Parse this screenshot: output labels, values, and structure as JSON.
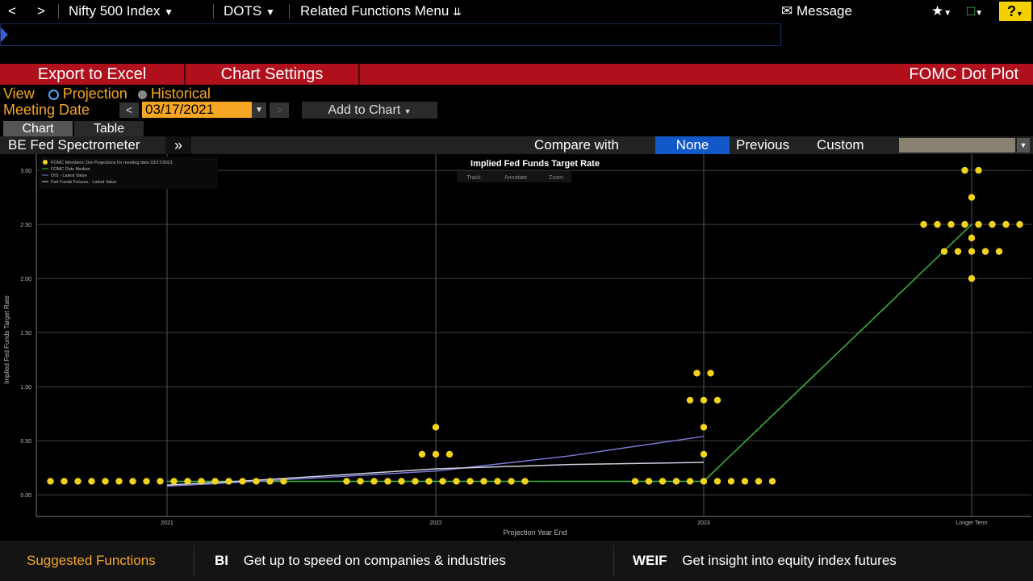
{
  "topbar": {
    "back": "<",
    "forward": ">",
    "security": "Nifty 500 Index",
    "function": "DOTS",
    "related": "Related Functions Menu",
    "message": "Message",
    "help": "?"
  },
  "actions": {
    "export": "Export to Excel",
    "settings": "Chart Settings",
    "title": "FOMC Dot Plot"
  },
  "view": {
    "label": "View",
    "projection": "Projection",
    "historical": "Historical"
  },
  "meeting": {
    "label": "Meeting Date",
    "date": "03/17/2021",
    "prev": "<",
    "next": ">",
    "add_to_chart": "Add to Chart"
  },
  "tabs": [
    "Chart",
    "Table"
  ],
  "spectrometer": {
    "label": "BE Fed Spectrometer",
    "expand": "»",
    "compare_label": "Compare with",
    "options": [
      "None",
      "Previous",
      "Custom"
    ],
    "selected": "None"
  },
  "chart_data": {
    "type": "scatter",
    "title": "Implied Fed Funds Target Rate",
    "tools": [
      "Track",
      "Annotate",
      "Zoom"
    ],
    "xlabel": "Projection Year End",
    "ylabel": "Implied Fed Funds Target Rate",
    "categories": [
      "2021",
      "2022",
      "2023",
      "Longer Term"
    ],
    "ylim": [
      -0.2,
      3.15
    ],
    "yticks": [
      "3.00",
      "2.50",
      "2.00",
      "1.50",
      "1.00",
      "0.50",
      "0.00"
    ],
    "legend": [
      "FOMC Members' Dot Projections for meeting date 03/17/2021",
      "FOMC Dots Median",
      "OIS - Latest Value",
      "Fed Funds Futures - Latest Value"
    ],
    "colors": {
      "dots": "#f2d31b",
      "median": "#3dbb3d",
      "ois": "#7a7ad8",
      "futures": "#d0d0e0",
      "grid": "#404040"
    },
    "dots": [
      {
        "x": "2021",
        "y": 0.125,
        "count": 18
      },
      {
        "x": "2022",
        "y": 0.125,
        "count": 14
      },
      {
        "x": "2022",
        "y": 0.375,
        "count": 3
      },
      {
        "x": "2022",
        "y": 0.625,
        "count": 1
      },
      {
        "x": "2023",
        "y": 0.125,
        "count": 11
      },
      {
        "x": "2023",
        "y": 0.375,
        "count": 1
      },
      {
        "x": "2023",
        "y": 0.625,
        "count": 1
      },
      {
        "x": "2023",
        "y": 0.875,
        "count": 3
      },
      {
        "x": "2023",
        "y": 1.125,
        "count": 2
      },
      {
        "x": "Longer Term",
        "y": 2.0,
        "count": 1
      },
      {
        "x": "Longer Term",
        "y": 2.25,
        "count": 5
      },
      {
        "x": "Longer Term",
        "y": 2.375,
        "count": 1
      },
      {
        "x": "Longer Term",
        "y": 2.5,
        "count": 8
      },
      {
        "x": "Longer Term",
        "y": 2.75,
        "count": 1
      },
      {
        "x": "Longer Term",
        "y": 3.0,
        "count": 2
      }
    ],
    "series": [
      {
        "name": "FOMC Dots Median",
        "points": [
          [
            0.0,
            0.125
          ],
          [
            1.0,
            0.125
          ],
          [
            2.0,
            0.125
          ],
          [
            3.0,
            2.5
          ]
        ]
      },
      {
        "name": "OIS - Latest Value",
        "points": [
          [
            0.0,
            0.08
          ],
          [
            0.3,
            0.12
          ],
          [
            1.0,
            0.22
          ],
          [
            1.5,
            0.36
          ],
          [
            2.0,
            0.54
          ]
        ]
      },
      {
        "name": "Fed Funds Futures - Latest Value",
        "points": [
          [
            0.0,
            0.09
          ],
          [
            0.3,
            0.13
          ],
          [
            1.0,
            0.24
          ],
          [
            1.5,
            0.28
          ],
          [
            2.0,
            0.3
          ]
        ]
      }
    ]
  },
  "suggested": {
    "label": "Suggested Functions",
    "items": [
      {
        "code": "BI",
        "text": "Get up to speed on companies & industries"
      },
      {
        "code": "WEIF",
        "text": "Get insight into equity index futures"
      }
    ]
  }
}
